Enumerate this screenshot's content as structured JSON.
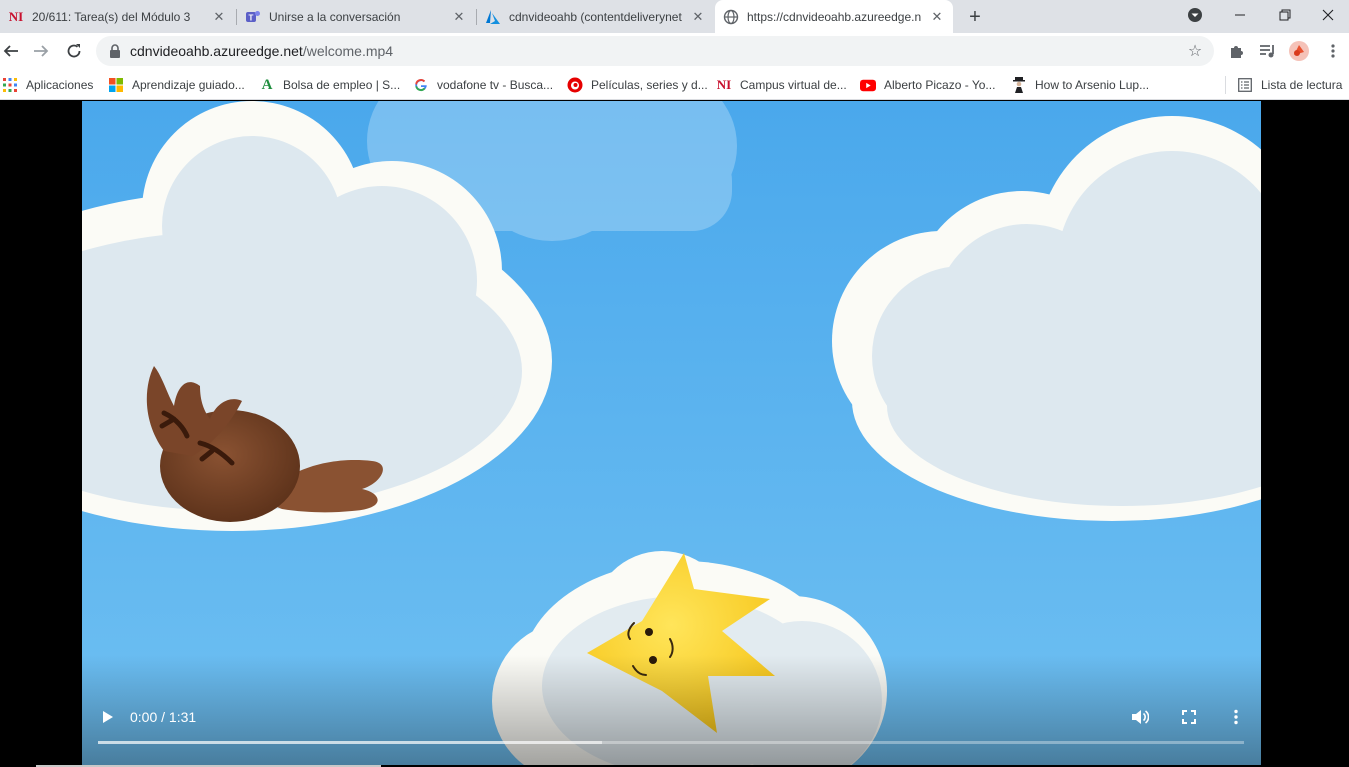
{
  "tabs": [
    {
      "title": "20/611: Tarea(s) del Módulo 3",
      "favicon": "ni-logo-icon",
      "active": false
    },
    {
      "title": "Unirse a la conversación",
      "favicon": "teams-icon",
      "active": false
    },
    {
      "title": "cdnvideoahb (contentdeliverynet",
      "favicon": "azure-icon",
      "active": false
    },
    {
      "title": "https://cdnvideoahb.azureedge.n",
      "favicon": "globe-icon",
      "active": true
    }
  ],
  "address": {
    "host": "cdnvideoahb.azureedge.net",
    "path": "/welcome.mp4"
  },
  "bookmarks": [
    {
      "label": "Aplicaciones",
      "icon": "apps-grid-icon"
    },
    {
      "label": "Aprendizaje guiado...",
      "icon": "microsoft-icon"
    },
    {
      "label": "Bolsa de empleo | S...",
      "icon": "green-a-icon"
    },
    {
      "label": "vodafone tv - Busca...",
      "icon": "google-icon"
    },
    {
      "label": "Películas, series y d...",
      "icon": "vodafone-icon"
    },
    {
      "label": "Campus virtual de...",
      "icon": "ni-logo-icon"
    },
    {
      "label": "Alberto Picazo - Yo...",
      "icon": "youtube-icon"
    },
    {
      "label": "How to Arsenio Lup...",
      "icon": "figure-icon"
    }
  ],
  "reading_list": {
    "label": "Lista de lectura"
  },
  "player": {
    "time": "0:00 / 1:31",
    "played_fraction": 0.0,
    "buffered_fraction": 0.44
  },
  "colors": {
    "ni_red": "#c8102e",
    "teams_purple": "#5b5fc7",
    "azure_blue": "#0078d4",
    "sky": "#5fb6ee"
  }
}
